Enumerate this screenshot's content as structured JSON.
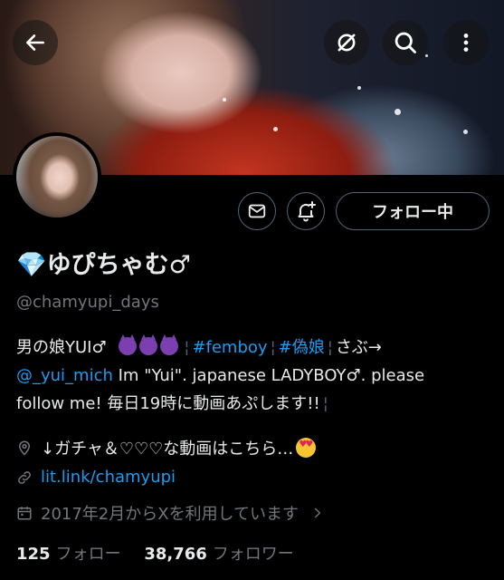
{
  "profile": {
    "display_name": "💎ゆぴちゃむ♂",
    "handle": "@chamyupi_days",
    "follow_button_label": "フォロー中"
  },
  "bio": {
    "line1_text": "男の娘YUI♂",
    "tag_femboy": "#femboy",
    "tag_nisemusume": "#偽娘",
    "line1_tail": "さぶ→",
    "mention": "@_yui_mich",
    "line2_text": " Im \"Yui\". japanese LADYBOY♂. please",
    "line3_text": "follow me! 毎日19時に動画あぷします!!"
  },
  "meta": {
    "location": "↓ガチャ＆♡♡♡な動画はこちら…",
    "website": "lit.link/chamyupi",
    "joined": "2017年2月からXを利用しています"
  },
  "stats": {
    "following_count": "125",
    "following_label": "フォロー",
    "followers_count": "38,766",
    "followers_label": "フォロワー"
  },
  "icons": [
    "back-arrow-icon",
    "no-notifications-icon",
    "search-icon",
    "more-vertical-icon",
    "mail-icon",
    "bell-plus-icon",
    "location-icon",
    "link-icon",
    "calendar-icon",
    "chevron-right-icon"
  ],
  "colors": {
    "accent": "#1d9bf0",
    "secondary_text": "#71767b",
    "background": "#000000"
  }
}
